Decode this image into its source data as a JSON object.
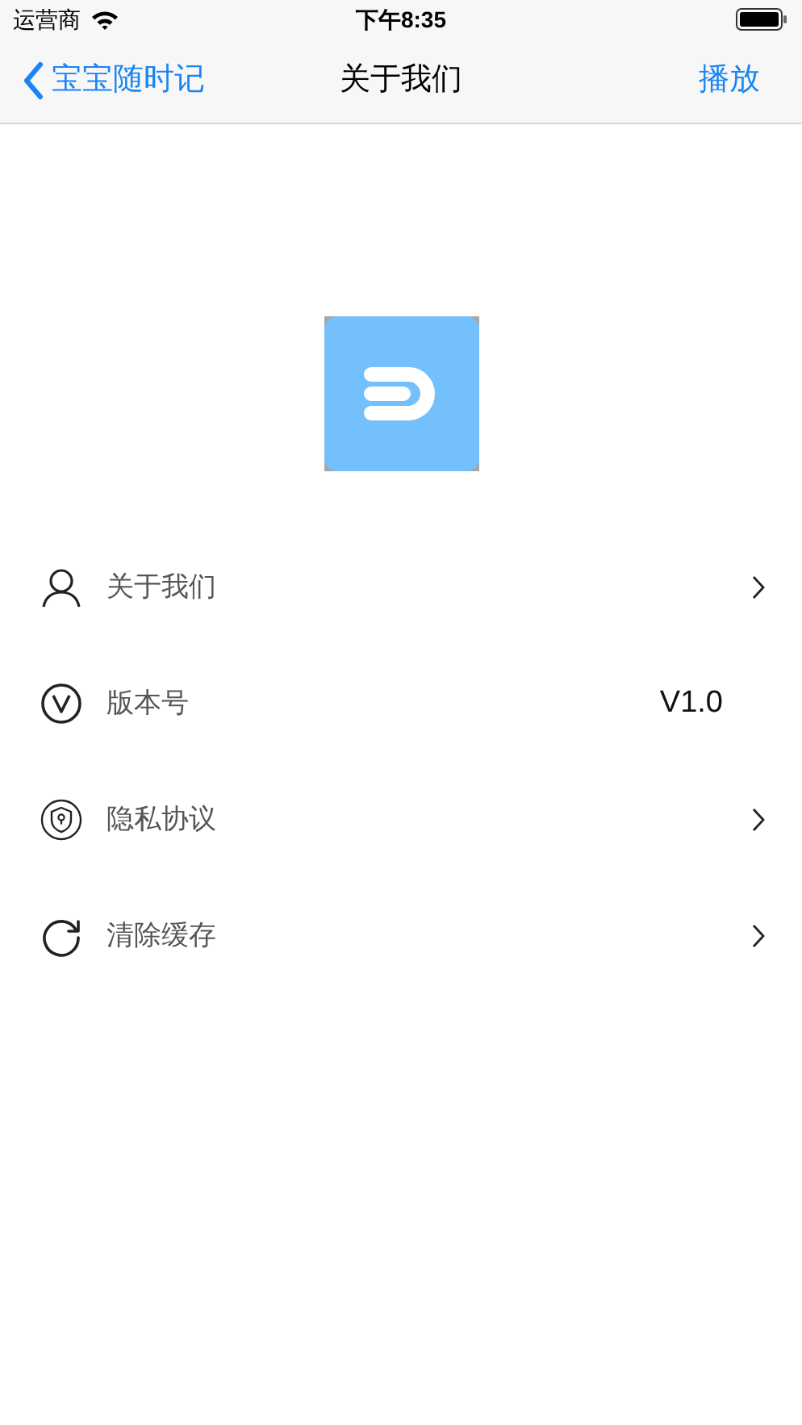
{
  "status_bar": {
    "carrier": "运营商",
    "time": "下午8:35"
  },
  "nav": {
    "back": "宝宝随时记",
    "title": "关于我们",
    "action": "播放"
  },
  "rows": [
    {
      "kind": "link",
      "label": "关于我们"
    },
    {
      "kind": "value",
      "label": "版本号",
      "value": "V1.0"
    },
    {
      "kind": "link",
      "label": "隐私协议"
    },
    {
      "kind": "link",
      "label": "清除缓存"
    }
  ]
}
